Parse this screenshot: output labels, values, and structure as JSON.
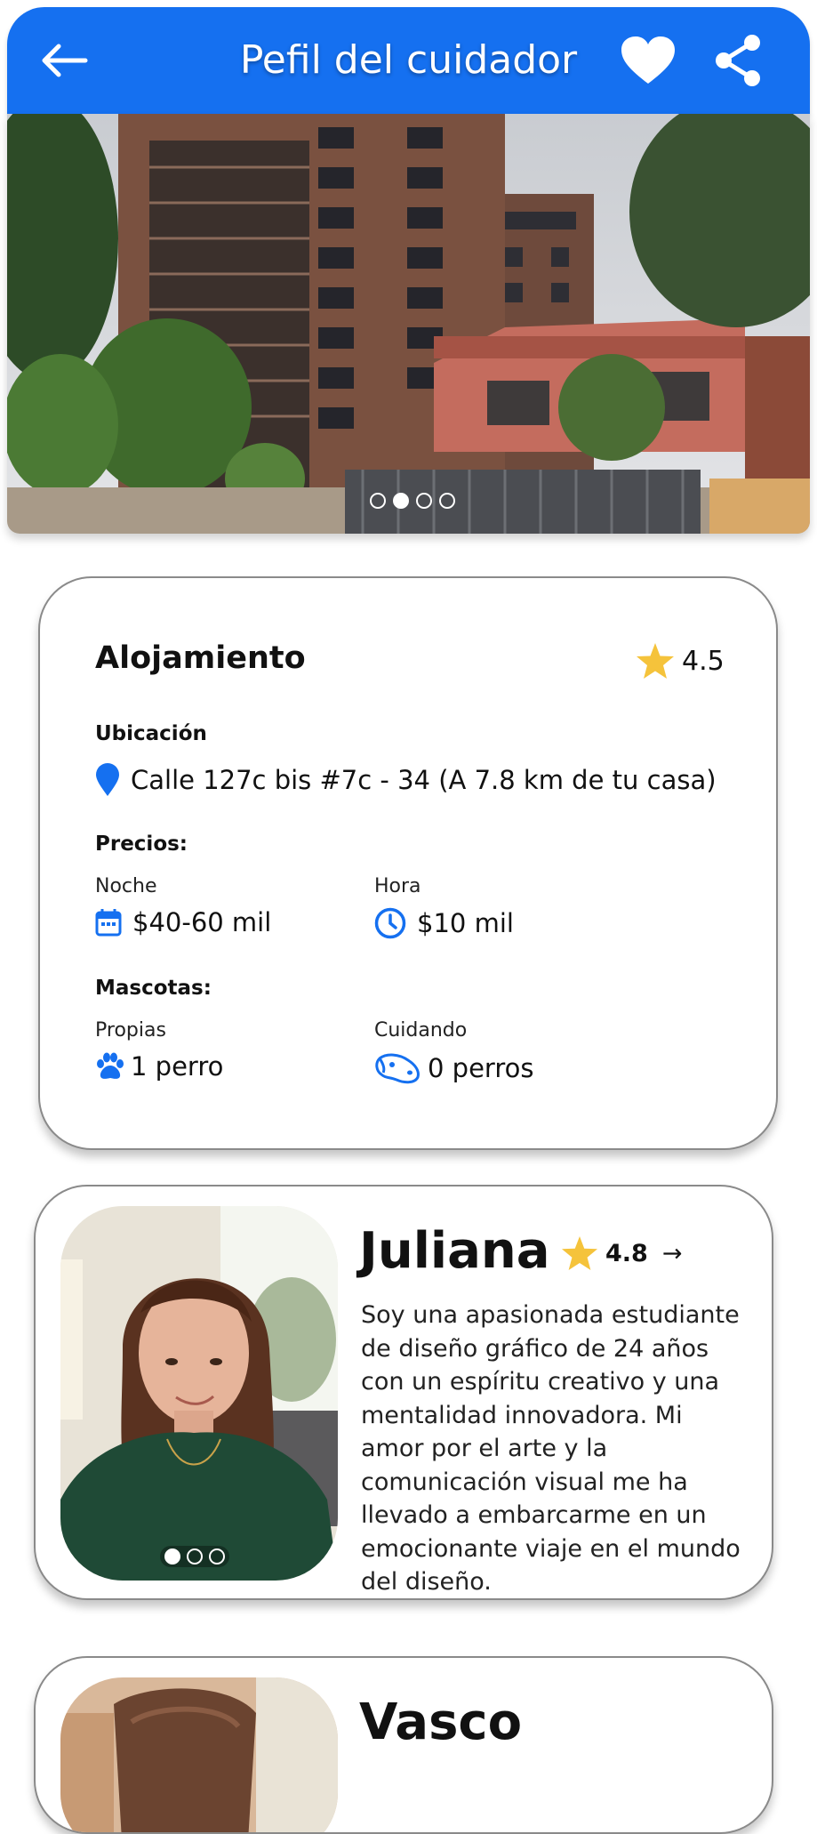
{
  "header": {
    "title": "Pefil del cuidador",
    "back_icon": "arrow-left-icon",
    "favorite_icon": "heart-icon",
    "share_icon": "share-icon",
    "color": "#1570f0"
  },
  "hero": {
    "carousel_dots": 4,
    "active_dot": 1
  },
  "accommodation": {
    "title": "Alojamiento",
    "rating": "4.5",
    "location_label": "Ubicación",
    "address": "Calle 127c bis #7c - 34  (A 7.8 km de tu casa)",
    "prices_label": "Precios:",
    "night_label": "Noche",
    "night_price": "$40-60 mil",
    "hour_label": "Hora",
    "hour_price": "$10 mil",
    "pets_label": "Mascotas:",
    "own_label": "Propias",
    "own_value": "1 perro",
    "caring_label": "Cuidando",
    "caring_value": "0 perros"
  },
  "caregivers": [
    {
      "name": "Juliana",
      "rating": "4.8",
      "arrow": "→",
      "bio": "Soy una apasionada estudiante de diseño gráfico de 24 años con un espíritu creativo y una mentalidad innovadora. Mi amor por el arte y la comunicación visual me ha llevado a embarcarme en un emocionante viaje en el mundo del diseño.",
      "photo_dots": 3,
      "active_dot": 0
    },
    {
      "name": "Vasco"
    }
  ],
  "colors": {
    "accent": "#1570f0",
    "star": "#f5c33b"
  }
}
